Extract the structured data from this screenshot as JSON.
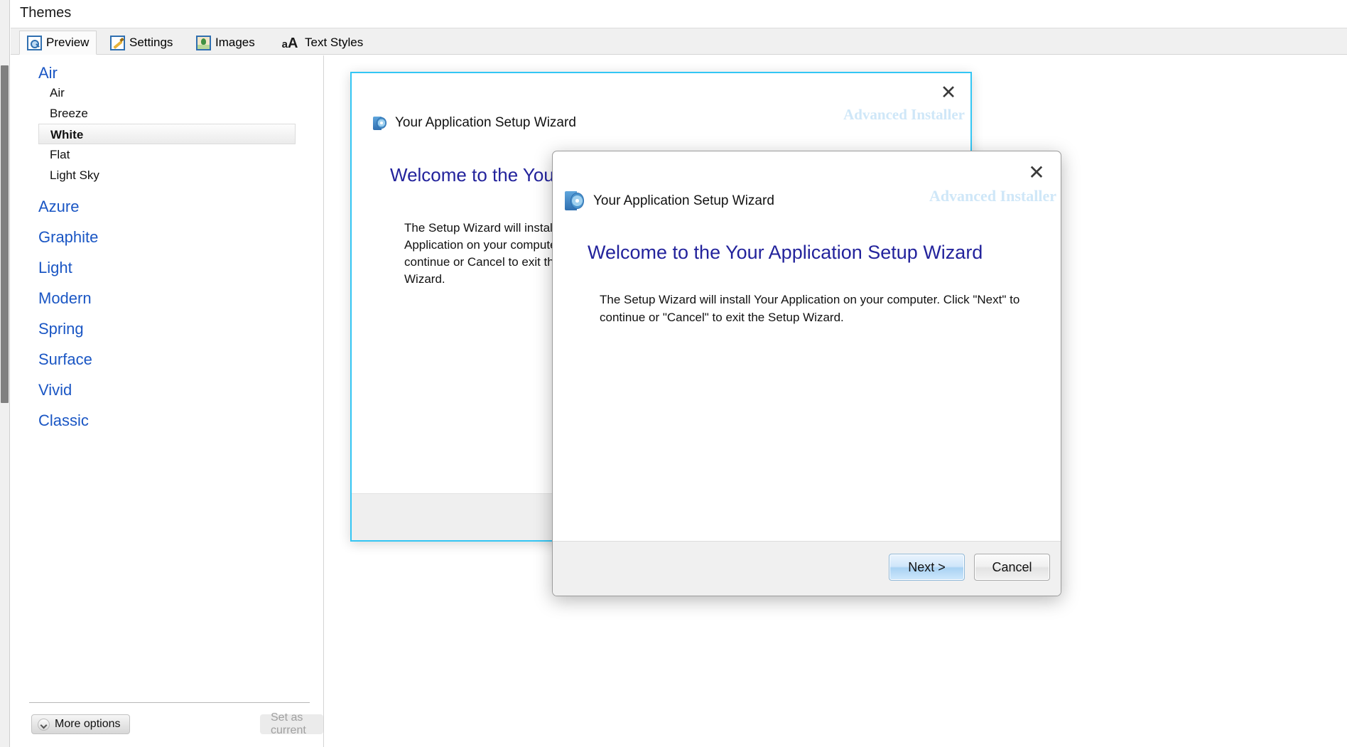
{
  "window": {
    "title": "Themes"
  },
  "tabs": [
    {
      "label": "Preview",
      "icon": "preview-icon",
      "active": true
    },
    {
      "label": "Settings",
      "icon": "settings-icon",
      "active": false
    },
    {
      "label": "Images",
      "icon": "images-icon",
      "active": false
    },
    {
      "label": "Text Styles",
      "icon": "text-styles-icon",
      "active": false
    }
  ],
  "theme_list": {
    "groups": [
      {
        "name": "Air",
        "items": [
          {
            "label": "Air",
            "selected": false
          },
          {
            "label": "Breeze",
            "selected": false
          },
          {
            "label": "White",
            "selected": true
          },
          {
            "label": "Flat",
            "selected": false
          },
          {
            "label": "Light Sky",
            "selected": false
          }
        ]
      },
      {
        "name": "Azure",
        "items": []
      },
      {
        "name": "Graphite",
        "items": []
      },
      {
        "name": "Light",
        "items": []
      },
      {
        "name": "Modern",
        "items": []
      },
      {
        "name": "Spring",
        "items": []
      },
      {
        "name": "Surface",
        "items": []
      },
      {
        "name": "Vivid",
        "items": []
      },
      {
        "name": "Classic",
        "items": []
      }
    ]
  },
  "footer": {
    "more_options_label": "More options",
    "more_options_icon": "chevron-down-icon",
    "set_as_current_label": "Set as current",
    "set_as_current_enabled": false
  },
  "preview": {
    "back_window": {
      "title": "Your Application Setup Wizard",
      "watermark": "Advanced Installer",
      "heading": "Welcome to the Your Application Setup Wizard",
      "body": "The Setup Wizard will install Your Application on your computer. Click Next to continue or Cancel to exit the Setup Wizard.",
      "close_icon": "close-icon",
      "app_icon": "disc-icon",
      "border_color": "#33c6f4"
    },
    "front_window": {
      "title": "Your Application Setup Wizard",
      "watermark": "Advanced Installer",
      "heading": "Welcome to the Your Application Setup Wizard",
      "body": "The Setup Wizard will install Your Application on your computer.  Click \"Next\" to continue or \"Cancel\" to exit the Setup Wizard.",
      "close_icon": "close-icon",
      "app_icon": "disc-icon",
      "next_label": "Next >",
      "cancel_label": "Cancel"
    }
  },
  "colors": {
    "category_link": "#1a56c4",
    "heading": "#23239c",
    "watermark": "#cfe7f8",
    "accent_border": "#33c6f4"
  },
  "icons": {
    "close": "✕"
  }
}
